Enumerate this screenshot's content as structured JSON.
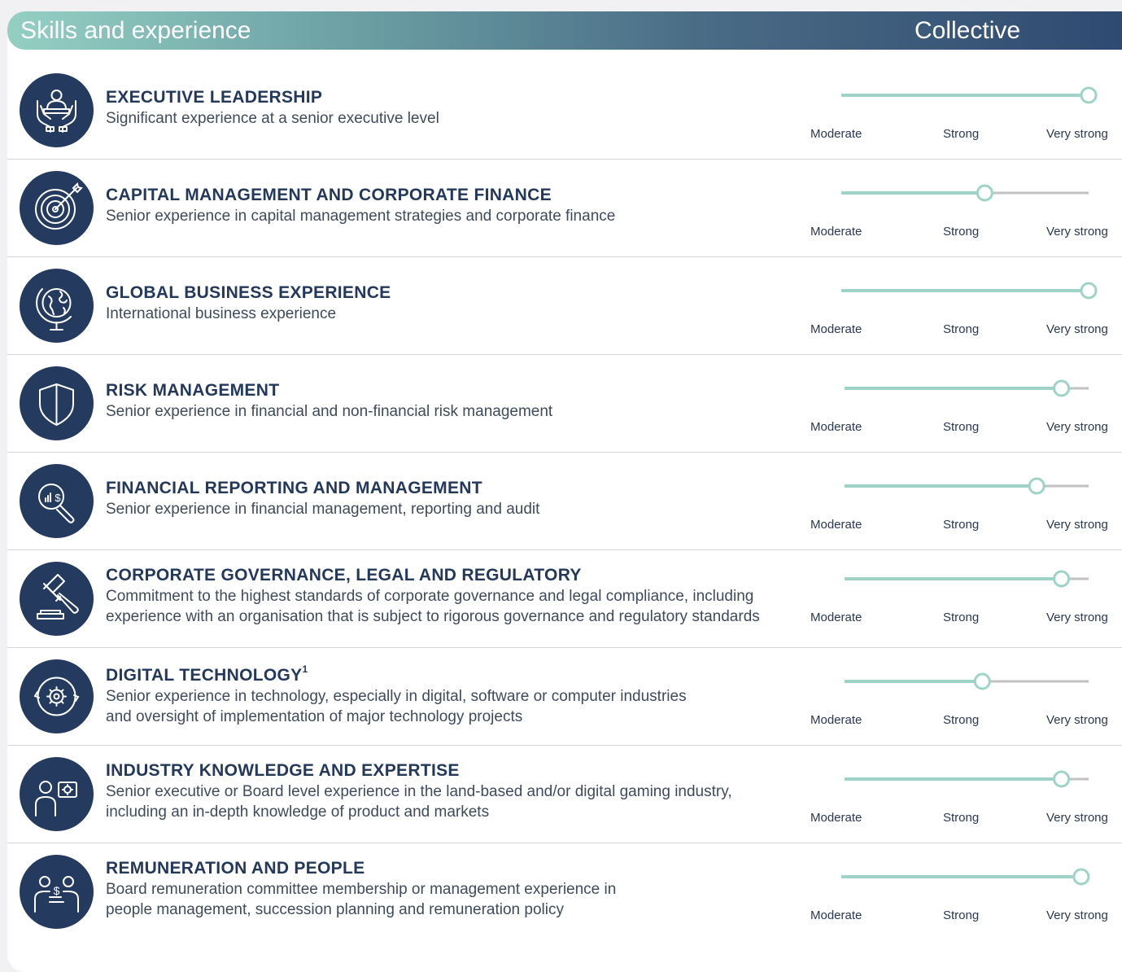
{
  "header": {
    "title": "Skills and experience",
    "collective": "Collective"
  },
  "scale_labels": [
    "Moderate",
    "Strong",
    "Very strong"
  ],
  "colors": {
    "navy": "#243a5e",
    "teal": "#9fd3c7",
    "grey_track": "#c2c2c4"
  },
  "skills": [
    {
      "icon": "leadership-icon",
      "title": "EXECUTIVE LEADERSHIP",
      "sup": "",
      "desc": "Significant experience at a senior executive level",
      "desc2": "",
      "level": 1.0
    },
    {
      "icon": "target-icon",
      "title": "CAPITAL MANAGEMENT AND CORPORATE FINANCE",
      "sup": "",
      "desc": "Senior experience in capital management strategies and corporate finance",
      "desc2": "",
      "level": 0.58
    },
    {
      "icon": "globe-icon",
      "title": "GLOBAL BUSINESS EXPERIENCE",
      "sup": "",
      "desc": "International business experience",
      "desc2": "",
      "level": 1.0
    },
    {
      "icon": "shield-icon",
      "title": "RISK MANAGEMENT",
      "sup": "",
      "desc": "Senior experience in financial and non-financial risk management",
      "desc2": "",
      "level": 0.89
    },
    {
      "icon": "magnifier-dollar-icon",
      "title": "FINANCIAL REPORTING AND MANAGEMENT",
      "sup": "",
      "desc": "Senior experience in financial management, reporting and audit",
      "desc2": "",
      "level": 0.79
    },
    {
      "icon": "gavel-icon",
      "title": "CORPORATE GOVERNANCE, LEGAL AND REGULATORY",
      "sup": "",
      "desc": "Commitment to the highest standards of corporate governance and legal compliance, including",
      "desc2": "experience with an organisation that is subject to rigorous governance and regulatory standards",
      "level": 0.89
    },
    {
      "icon": "digital-gear-icon",
      "title": "DIGITAL TECHNOLOGY",
      "sup": "1",
      "desc": "Senior experience in technology, especially in digital, software or computer industries",
      "desc2": "and oversight of implementation of major technology projects",
      "level": 0.57
    },
    {
      "icon": "person-gear-icon",
      "title": "INDUSTRY KNOWLEDGE AND EXPERTISE",
      "sup": "",
      "desc": "Senior executive or Board level experience in the land-based and/or digital gaming industry,",
      "desc2": "including an in-depth knowledge of product and markets",
      "level": 0.89
    },
    {
      "icon": "people-dollar-icon",
      "title": "REMUNERATION AND PEOPLE",
      "sup": "",
      "desc": "Board remuneration committee membership or management experience in",
      "desc2": "people management, succession planning and remuneration policy",
      "level": 0.97
    }
  ]
}
